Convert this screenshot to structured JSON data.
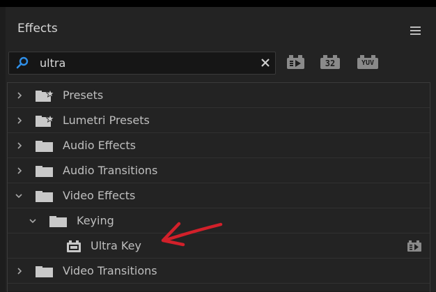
{
  "panel": {
    "title": "Effects"
  },
  "search": {
    "value": "ultra"
  },
  "filters": [
    {
      "name": "accelerated-effects",
      "label": ""
    },
    {
      "name": "32-bit",
      "label": "32"
    },
    {
      "name": "yuv",
      "label": "YUV"
    }
  ],
  "tree": [
    {
      "label": "Presets",
      "expanded": false,
      "icon": "folder-star-icon"
    },
    {
      "label": "Lumetri Presets",
      "expanded": false,
      "icon": "folder-star-icon"
    },
    {
      "label": "Audio Effects",
      "expanded": false,
      "icon": "folder-icon"
    },
    {
      "label": "Audio Transitions",
      "expanded": false,
      "icon": "folder-icon"
    },
    {
      "label": "Video Effects",
      "expanded": true,
      "icon": "folder-icon"
    },
    {
      "label": "Keying",
      "expanded": true,
      "icon": "folder-icon"
    },
    {
      "label": "Ultra Key",
      "icon": "effect-icon",
      "badge": "accelerated-icon"
    },
    {
      "label": "Video Transitions",
      "expanded": false,
      "icon": "folder-icon"
    }
  ],
  "colors": {
    "search_icon": "#2f8fe8",
    "annotation_arrow": "#d2202a"
  }
}
